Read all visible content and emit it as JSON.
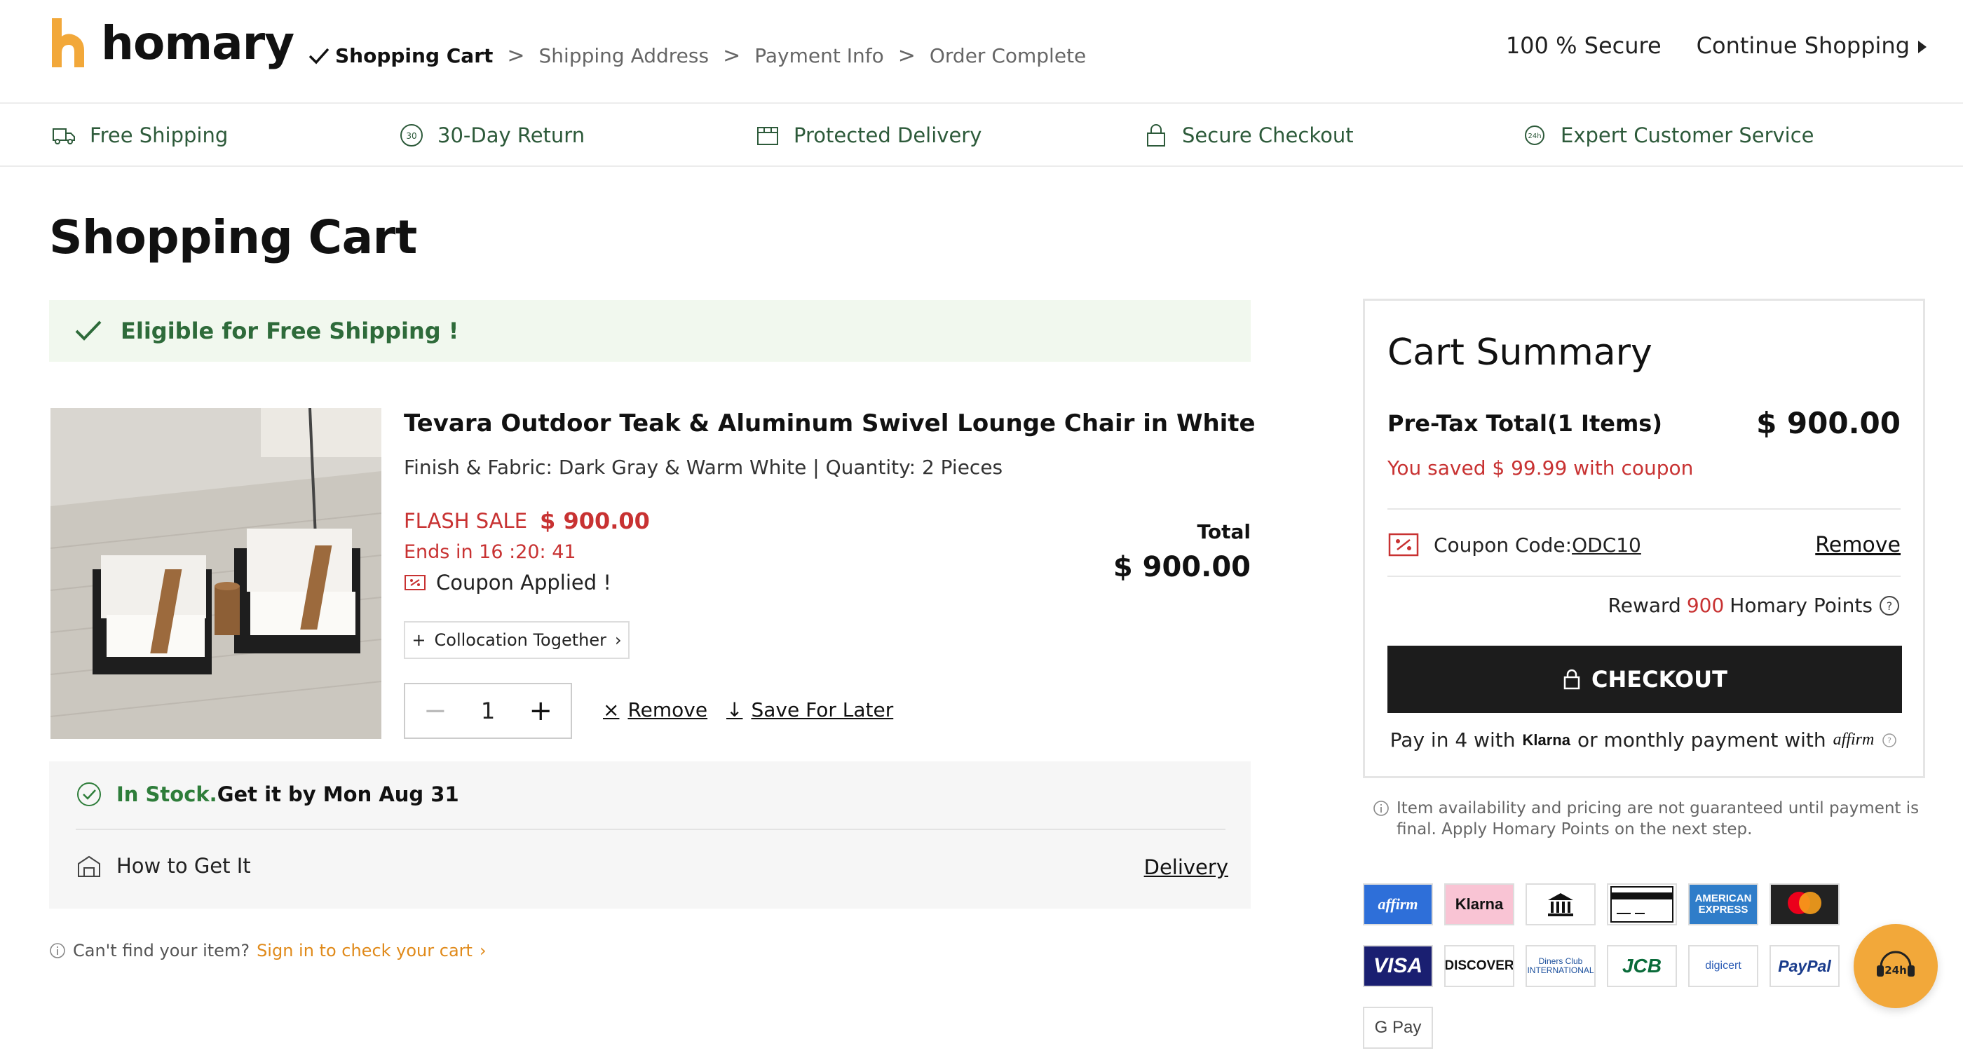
{
  "header": {
    "logo_text": "homary",
    "steps": [
      "Shopping Cart",
      "Shipping Address",
      "Payment Info",
      "Order Complete"
    ],
    "step_sep": ">",
    "secure": "100 % Secure",
    "continue": "Continue Shopping"
  },
  "features": [
    {
      "label": "Free Shipping",
      "icon": "truck-icon"
    },
    {
      "label": "30-Day Return",
      "icon": "return-30-icon"
    },
    {
      "label": "Protected Delivery",
      "icon": "box-icon"
    },
    {
      "label": "Secure Checkout",
      "icon": "lock-icon"
    },
    {
      "label": "Expert Customer Service",
      "icon": "support-24h-icon"
    }
  ],
  "page_title": "Shopping Cart",
  "eligible": "Eligible for Free Shipping !",
  "product": {
    "name": "Tevara Outdoor Teak & Aluminum Swivel Lounge Chair in White",
    "options": "Finish & Fabric: Dark Gray & Warm White  |  Quantity: 2 Pieces",
    "flash_label": "FLASH SALE",
    "flash_price": "$ 900.00",
    "ends": "Ends in  16 :20: 41",
    "coupon_applied": "Coupon Applied !",
    "collocation": "Collocation Together",
    "quantity": "1",
    "remove": "Remove",
    "save_later": "Save For Later",
    "total_label": "Total",
    "total_value": "$ 900.00"
  },
  "stock": {
    "in_stock": "In Stock.",
    "eta": "Get it by Mon Aug 31",
    "how": "How to Get It",
    "delivery": "Delivery"
  },
  "cant_find": {
    "text": "Can't find your item?",
    "link": "Sign in to check your cart"
  },
  "summary": {
    "title": "Cart Summary",
    "pretax_label": "Pre-Tax Total(1 Items)",
    "pretax_value": "$ 900.00",
    "saved": "You saved $ 99.99 with coupon",
    "coupon_label": "Coupon Code:",
    "coupon_code": "ODC10",
    "coupon_remove": "Remove",
    "reward_prefix": "Reward",
    "reward_points": "900",
    "reward_suffix": "Homary Points",
    "checkout": "CHECKOUT",
    "payin_prefix": "Pay in 4 with",
    "payin_klarna": "Klarna",
    "payin_mid": "or monthly payment with",
    "payin_affirm": "affirm"
  },
  "note": "Item availability and pricing are not guaranteed until payment is final. Apply Homary Points on the next step.",
  "payment_methods": [
    "affirm",
    "Klarna",
    "bank",
    "card",
    "AMERICAN EXPRESS",
    "mastercard",
    "VISA",
    "DISCOVER",
    "Diners Club INTERNATIONAL",
    "JCB",
    "digicert",
    "PayPal",
    "G Pay"
  ],
  "chat": "24h",
  "colors": {
    "green": "#2e6b3a",
    "red": "#c83232",
    "orange": "#f2a83a",
    "dark": "#1c1c1c"
  }
}
